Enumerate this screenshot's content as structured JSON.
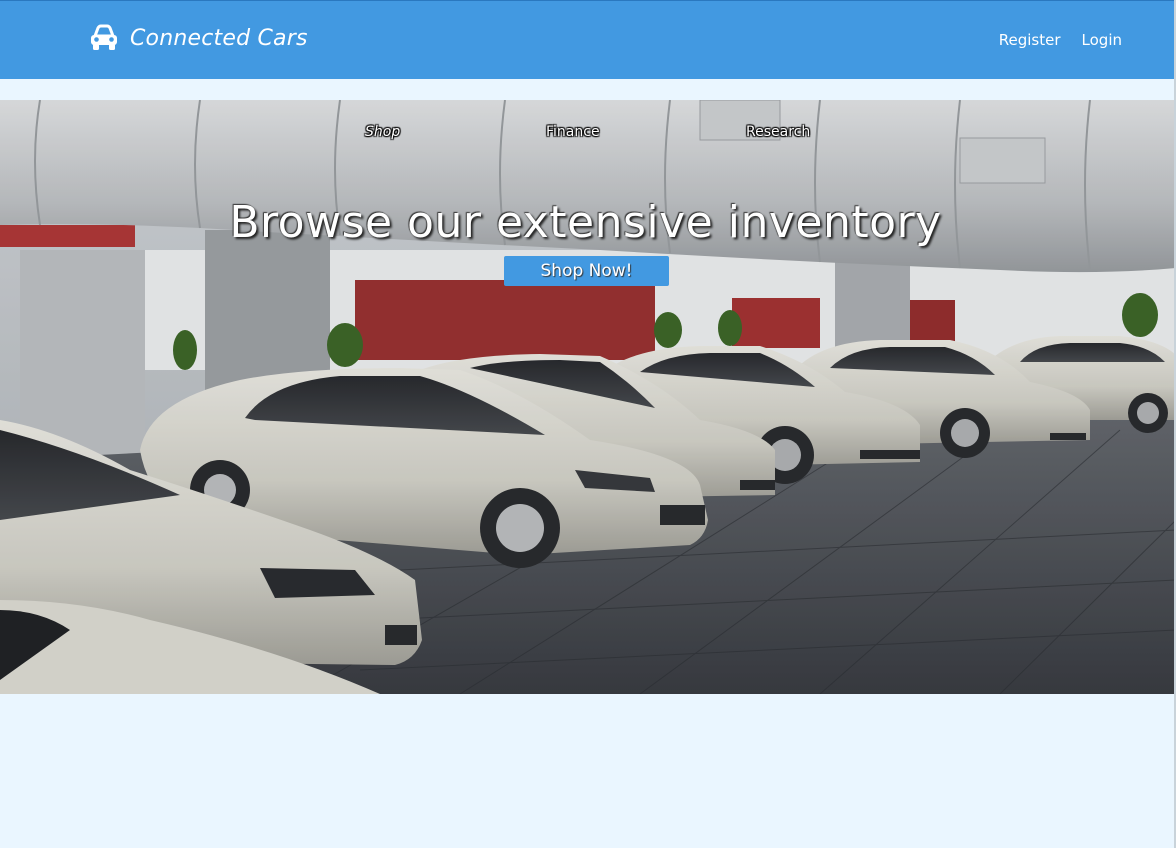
{
  "header": {
    "brand_name": "Connected Cars",
    "brand_icon": "car-icon",
    "register_label": "Register",
    "login_label": "Login",
    "bar_color": "#4299e1"
  },
  "subnav": {
    "items": [
      {
        "label": "Shop"
      },
      {
        "label": "Finance"
      },
      {
        "label": "Research"
      }
    ]
  },
  "hero": {
    "title": "Browse our extensive inventory",
    "cta_label": "Shop Now!",
    "image": "car-showroom-photo"
  },
  "colors": {
    "accent": "#4299e1",
    "page_background": "#eaf6ff"
  }
}
